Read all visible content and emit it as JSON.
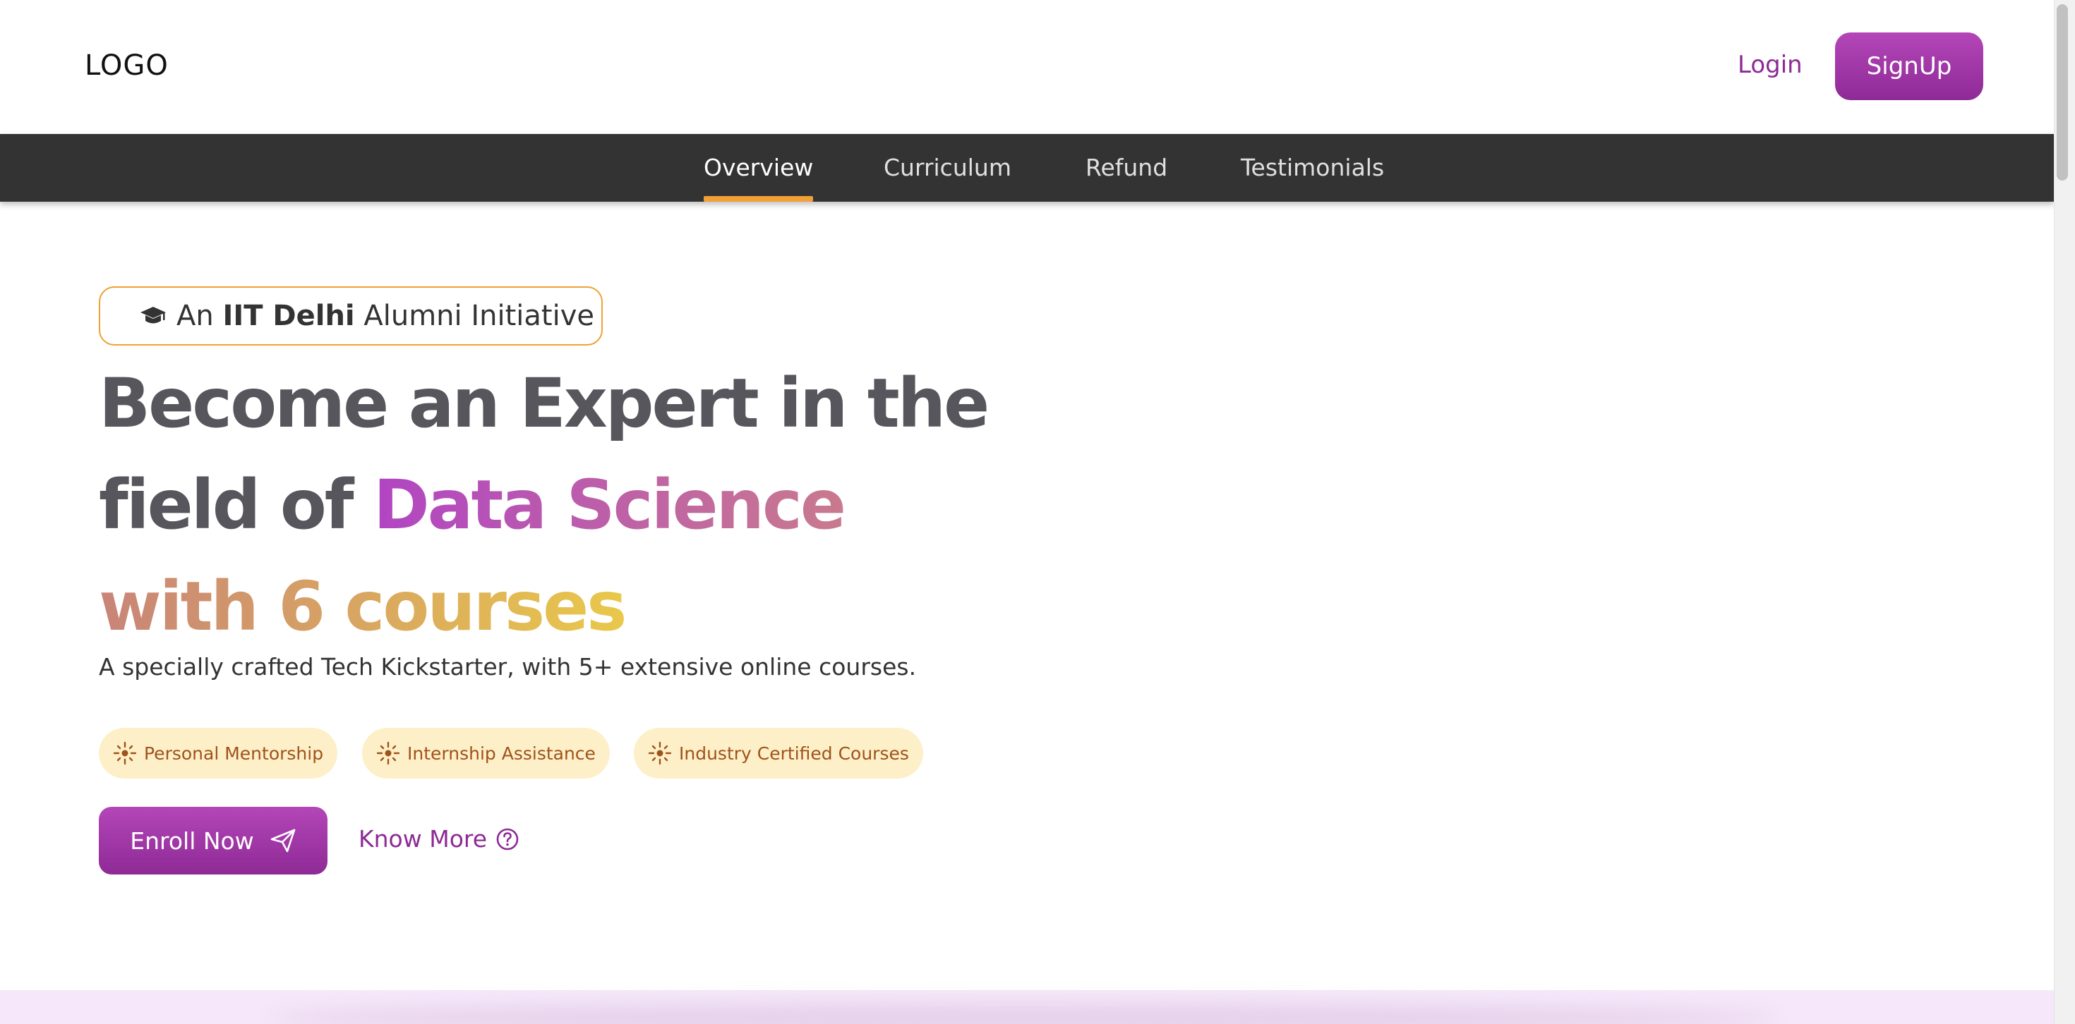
{
  "header": {
    "logo": "LOGO",
    "login_label": "Login",
    "signup_label": "SignUp"
  },
  "tabs": [
    {
      "label": "Overview",
      "active": true
    },
    {
      "label": "Curriculum",
      "active": false
    },
    {
      "label": "Refund",
      "active": false
    },
    {
      "label": "Testimonials",
      "active": false
    }
  ],
  "hero": {
    "badge": {
      "icon": "graduation-cap-icon",
      "prefix": "An",
      "bold": "IIT Delhi",
      "suffix": "Alumni Initiative"
    },
    "headline": {
      "line1": "Become an Expert in the",
      "line2_prefix": "field of",
      "line2_highlight": "Data Science",
      "line3": "with 6 courses"
    },
    "subtitle": "A specially crafted Tech Kickstarter, with 5+ extensive online courses.",
    "chips": [
      {
        "label": "Personal Mentorship",
        "icon": "sparkle-icon"
      },
      {
        "label": "Internship Assistance",
        "icon": "sparkle-icon"
      },
      {
        "label": "Industry Certified Courses",
        "icon": "sparkle-icon"
      }
    ],
    "enroll_label": "Enroll Now",
    "know_more_label": "Know More"
  },
  "colors": {
    "brand_purple": "#8e2a96",
    "accent_orange": "#f0a035",
    "tab_bar": "#333333",
    "chip_bg": "#fdf0c8",
    "chip_text": "#a0521b"
  }
}
